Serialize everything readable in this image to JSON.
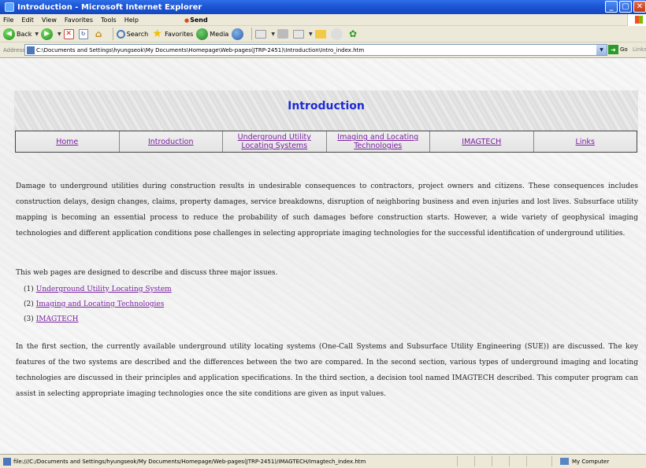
{
  "window": {
    "title": "Introduction - Microsoft Internet Explorer",
    "buttons": {
      "minimize": "_",
      "maximize": "▢",
      "close": "✕"
    }
  },
  "menubar": {
    "items": [
      "File",
      "Edit",
      "View",
      "Favorites",
      "Tools",
      "Help"
    ],
    "send": "Send"
  },
  "toolbar": {
    "back": "Back",
    "search": "Search",
    "favorites": "Favorites",
    "media": "Media"
  },
  "address": {
    "label": "Address",
    "value": "C:\\Documents and Settings\\hyungseok\\My Documents\\Homepage\\Web-pages(JTRP-2451)\\Introduction\\Intro_index.htm",
    "go": "Go",
    "links": "Links"
  },
  "page": {
    "title": "Introduction",
    "nav": [
      {
        "label": "Home"
      },
      {
        "label": "Introduction"
      },
      {
        "label": "Underground Utility Locating Systems"
      },
      {
        "label": "Imaging and Locating Technologies"
      },
      {
        "label": "IMAGTECH"
      },
      {
        "label": "Links"
      }
    ],
    "paragraph1": "Damage to underground utilities during construction results in undesirable consequences to contractors, project owners and citizens. These consequences includes construction delays, design changes, claims, property damages, service breakdowns, disruption of neighboring business and even injuries and lost lives.  Subsurface utility mapping is becoming an essential process to reduce the probability of such damages before construction starts. However, a wide variety of geophysical imaging technologies and different application conditions pose challenges in selecting appropriate imaging technologies for the successful identification of underground utilities.",
    "paragraph2": "This web pages are designed to describe and discuss three major issues.",
    "list": [
      {
        "num": "(1)",
        "label": "Underground Utility Locating System"
      },
      {
        "num": "(2)",
        "label": "Imaging and Locating Technologies"
      },
      {
        "num": "(3)",
        "label": "IMAGTECH"
      }
    ],
    "paragraph3": "In the first section, the currently available underground utility locating systems (One-Call Systems and Subsurface Utility Engineering (SUE)) are discussed. The key features of the two systems are described and the differences between the two are compared. In the second section, various types of underground imaging and locating technologies are discussed in their principles and application specifications. In the third section, a decision tool named IMAGTECH described. This computer program can assist in selecting appropriate imaging technologies once the site conditions are given as input values."
  },
  "status": {
    "text": "file:///C:/Documents and Settings/hyungseok/My Documents/Homepage/Web-pages(JTRP-2451)/IMAGTECH/Imagtech_index.htm",
    "zone": "My Computer"
  },
  "colors": {
    "title_blue": "#1d2bd6",
    "link_purple": "#7a1fa0",
    "xp_blue": "#1c55d4",
    "chrome": "#ece9d8"
  }
}
